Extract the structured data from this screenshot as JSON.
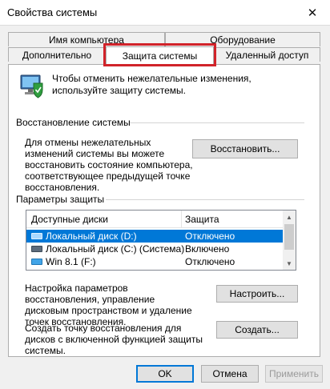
{
  "window": {
    "title": "Свойства системы",
    "close_glyph": "✕"
  },
  "tabs": {
    "row_top": [
      {
        "label": "Имя компьютера"
      },
      {
        "label": "Оборудование"
      }
    ],
    "row_bottom": [
      {
        "label": "Дополнительно"
      },
      {
        "label": "Защита системы",
        "active": true
      },
      {
        "label": "Удаленный доступ"
      }
    ]
  },
  "intro": {
    "text": "Чтобы отменить нежелательные изменения, используйте защиту системы."
  },
  "restore_group": {
    "title": "Восстановление системы",
    "description": "Для отмены нежелательных изменений системы вы можете восстановить состояние компьютера, соответствующее предыдущей точке восстановления.",
    "button_label": "Восстановить..."
  },
  "protection_group": {
    "title": "Параметры защиты",
    "columns": [
      "Доступные диски",
      "Защита"
    ],
    "drives": [
      {
        "name": "Локальный диск (D:)",
        "status": "Отключено",
        "icon": "hard-drive-icon",
        "selected": true
      },
      {
        "name": "Локальный диск (C:) (Система)",
        "status": "Включено",
        "icon": "hard-drive-icon",
        "selected": false
      },
      {
        "name": "Win 8.1 (F:)",
        "status": "Отключено",
        "icon": "windows-drive-icon",
        "selected": false
      }
    ],
    "configure_text": "Настройка параметров восстановления, управление дисковым пространством и удаление точек восстановления.",
    "configure_button": "Настроить...",
    "create_text": "Создать точку восстановления для дисков с включенной функцией защиты системы.",
    "create_button": "Создать..."
  },
  "dialog_buttons": {
    "ok": "OK",
    "cancel": "Отмена",
    "apply": "Применить"
  },
  "colors": {
    "selection": "#0078d7",
    "highlight_frame": "#d1232a"
  }
}
